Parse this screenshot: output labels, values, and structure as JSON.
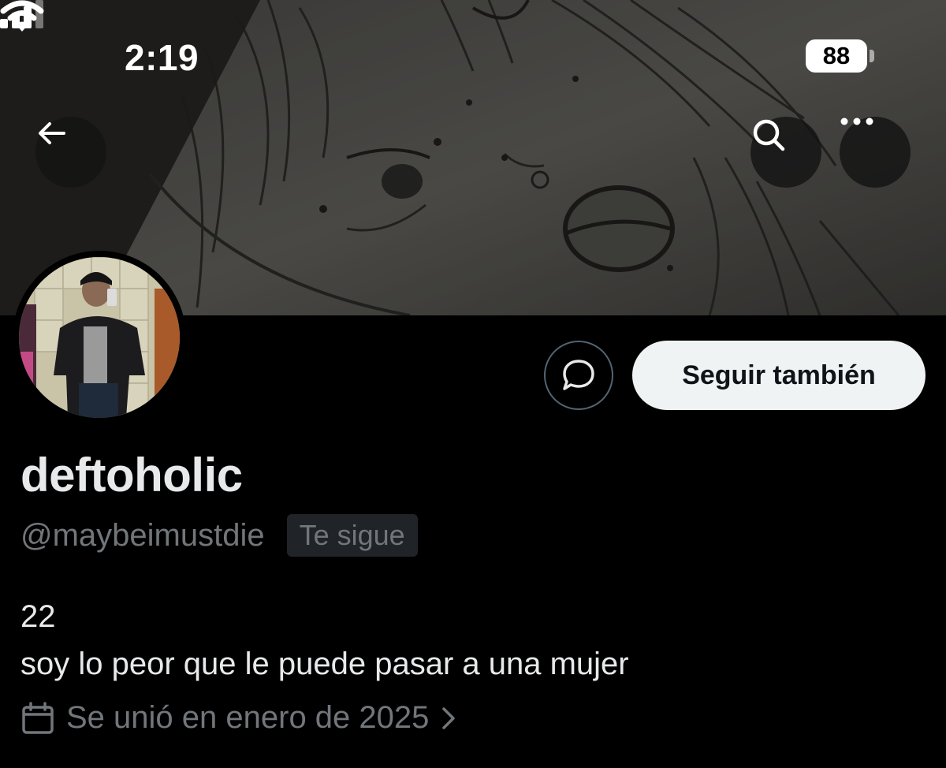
{
  "status_bar": {
    "time": "2:19",
    "battery": "88",
    "icons": [
      "signal-icon",
      "wifi-icon",
      "battery-icon"
    ]
  },
  "header": {
    "icons": [
      "back-arrow-icon",
      "search-icon",
      "more-icon"
    ]
  },
  "profile": {
    "display_name": "deftoholic",
    "handle": "@maybeimustdie",
    "follows_you_badge": "Te sigue",
    "bio_line_1": "22",
    "bio_line_2": "soy lo peor que le puede pasar a una mujer",
    "joined": "Se unió en enero de 2025"
  },
  "actions": {
    "follow_label": "Seguir también",
    "message_icon": "message-bubble-icon"
  },
  "colors": {
    "background": "#000000",
    "primary_text": "#e7e9ea",
    "secondary_text": "#71767b",
    "follow_button_bg": "#eff3f4",
    "badge_bg": "#202327"
  }
}
